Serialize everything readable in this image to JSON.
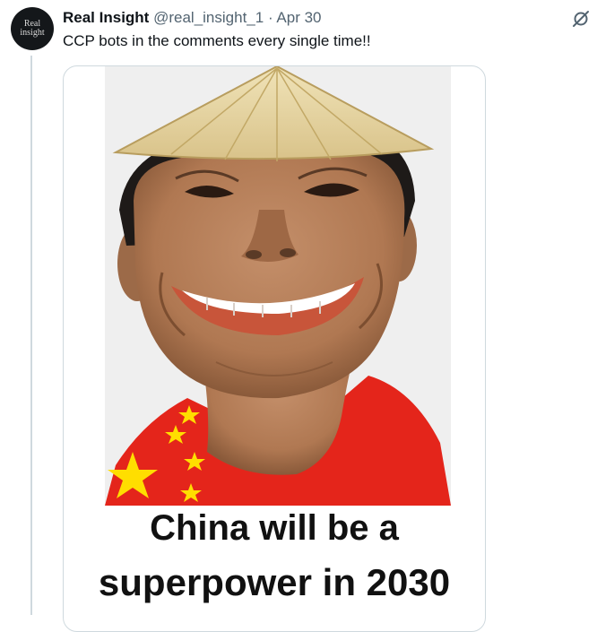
{
  "tweet": {
    "avatar_text": [
      "Real",
      "insight"
    ],
    "author_name": "Real Insight",
    "handle": "@real_insight_1",
    "separator": "·",
    "date": "Apr 30",
    "text": "CCP bots in the comments every single time!!"
  },
  "media": {
    "caption_line1": "China will be a",
    "caption_line2": "superpower in 2030"
  },
  "icons": {
    "grok": "grok-icon"
  },
  "colors": {
    "name": "#0f1419",
    "secondary": "#536471",
    "border": "#cfd9de",
    "flag_red": "#e4251b",
    "flag_star": "#ffde00"
  }
}
